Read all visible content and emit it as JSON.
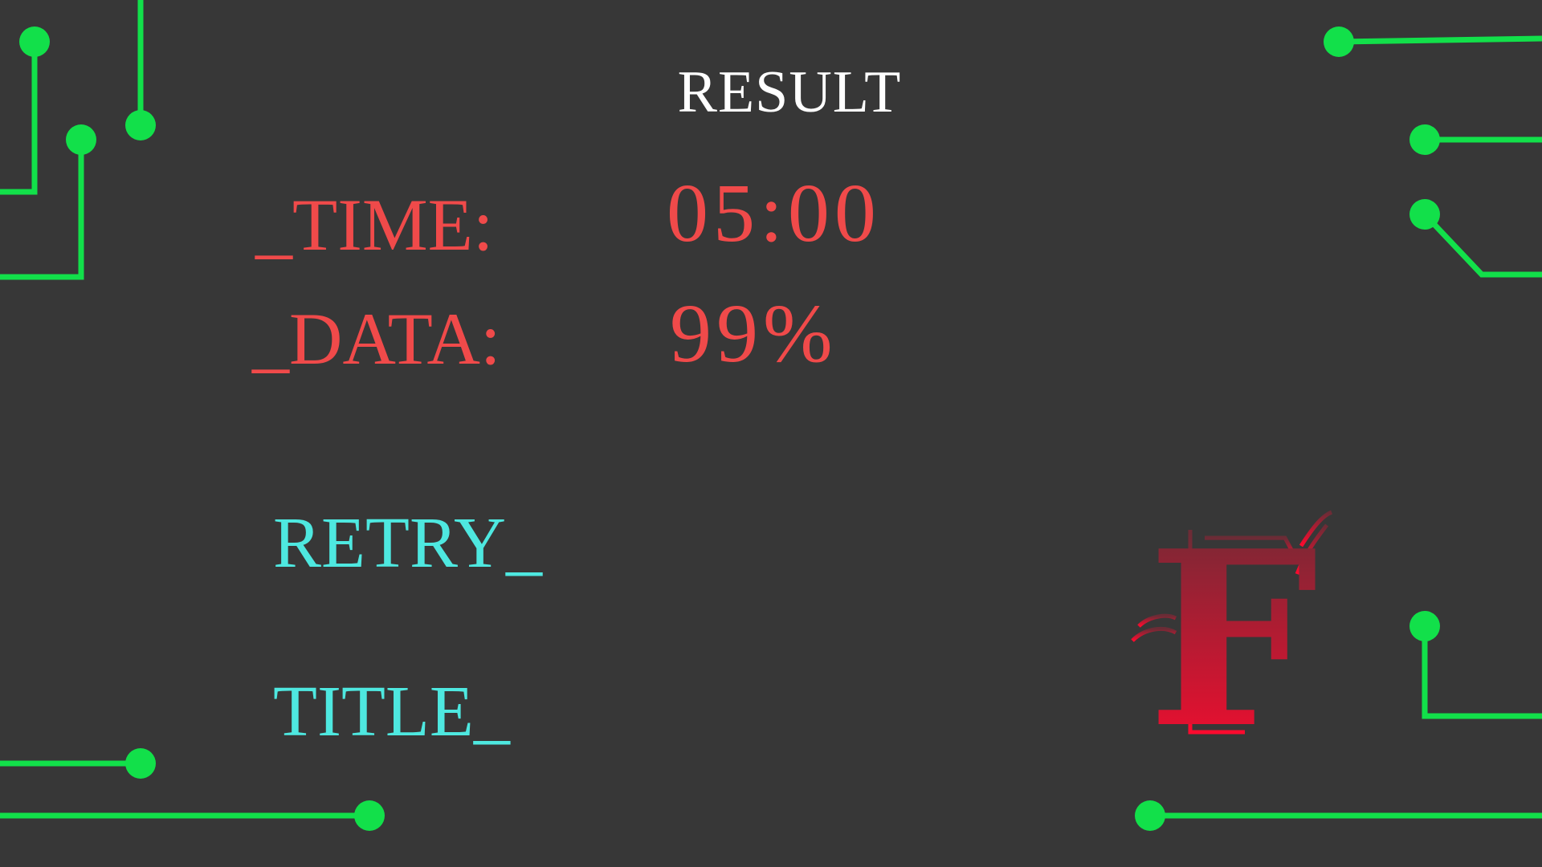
{
  "screen": {
    "title": "RESULT"
  },
  "stats": {
    "time_label": "_TIME:",
    "time_value": "05:00",
    "data_label": "_DATA:",
    "data_value": "99%"
  },
  "menu": {
    "retry_label": "RETRY_",
    "title_label": "TITLE_"
  },
  "grade": {
    "letter": "F"
  },
  "colors": {
    "background": "#373737",
    "circuit": "#12e04a",
    "stat_text": "#f04a4a",
    "menu_text": "#4ee8e0",
    "title_text": "#ffffff",
    "grade_top": "#6a2c36",
    "grade_bottom": "#ff0a2e"
  }
}
